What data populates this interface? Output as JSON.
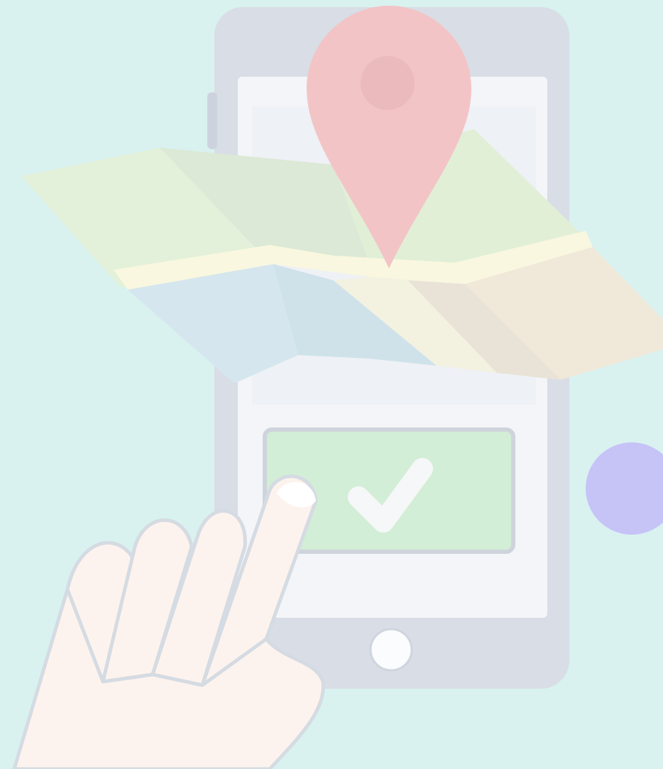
{
  "scene": {
    "description_colors": {
      "background": "#d9f2f0",
      "phone_body": "#d8dde6",
      "phone_screen": "#f3f5f8",
      "pin": "#f3c4c6",
      "confirm_button": "#d3eed6",
      "checkmark": "#f6f7f8",
      "hand": "#fdf3ee",
      "dot": "#c6c3f7"
    },
    "icons": {
      "pin": "map-pin-icon",
      "check": "checkmark-icon",
      "map": "folded-map-icon",
      "hand": "pointing-hand-icon"
    }
  }
}
